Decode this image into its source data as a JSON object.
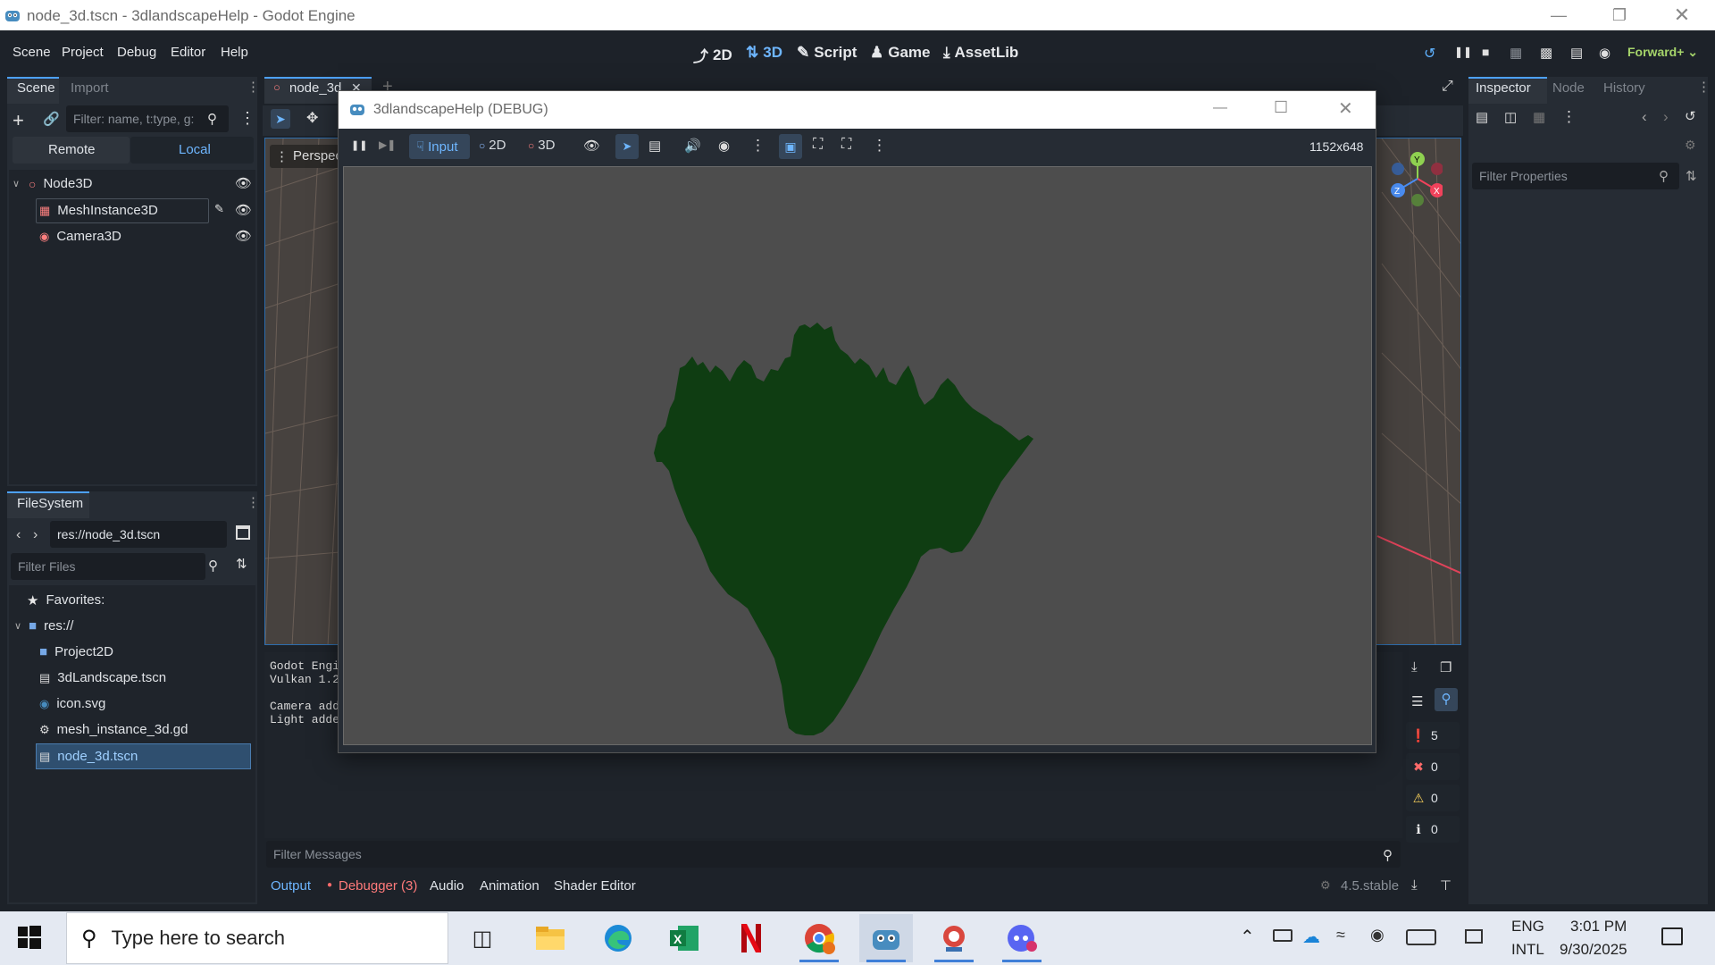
{
  "window": {
    "title": "node_3d.tscn - 3dlandscapeHelp - Godot Engine"
  },
  "menu": [
    "Scene",
    "Project",
    "Debug",
    "Editor",
    "Help"
  ],
  "workspaces": {
    "w2d": "2D",
    "w3d": "3D",
    "script": "Script",
    "game": "Game",
    "assetlib": "AssetLib"
  },
  "renderer": "Forward+",
  "scene_dock": {
    "tabs": [
      "Scene",
      "Import"
    ],
    "filter_placeholder": "Filter: name, t:type, g:",
    "remote": "Remote",
    "local": "Local",
    "nodes": [
      {
        "label": "Node3D"
      },
      {
        "label": "MeshInstance3D"
      },
      {
        "label": "Camera3D"
      }
    ]
  },
  "filesystem": {
    "title": "FileSystem",
    "path": "res://node_3d.tscn",
    "filter_placeholder": "Filter Files",
    "items": [
      {
        "label": "Favorites:"
      },
      {
        "label": "res://"
      },
      {
        "label": "Project2D"
      },
      {
        "label": "3dLandscape.tscn"
      },
      {
        "label": "icon.svg"
      },
      {
        "label": "mesh_instance_3d.gd"
      },
      {
        "label": "node_3d.tscn"
      }
    ]
  },
  "editor_tab": {
    "label": "node_3d"
  },
  "viewport": {
    "label": "Perspec"
  },
  "output": {
    "lines": [
      "Godot Engi",
      "Vulkan 1.2",
      "",
      "Camera add",
      "Light adde"
    ],
    "filter_placeholder": "Filter Messages",
    "tabs": [
      "Output",
      "Debugger (3)",
      "Audio",
      "Animation",
      "Shader Editor"
    ],
    "version": "4.5.stable",
    "counts": {
      "messages": "5",
      "errors": "0",
      "warnings": "0",
      "info": "0"
    }
  },
  "inspector": {
    "tabs": [
      "Inspector",
      "Node",
      "History"
    ],
    "filter_placeholder": "Filter Properties"
  },
  "game_window": {
    "title": "3dlandscapeHelp (DEBUG)",
    "toolbar": {
      "input": "Input",
      "mode2d": "2D",
      "mode3d": "3D",
      "resolution": "1152x648"
    },
    "terrain_color": "#0f3d12",
    "bg_color": "#4d4d4d"
  },
  "taskbar": {
    "search_placeholder": "Type here to search",
    "lang": "ENG",
    "lang2": "INTL",
    "time": "3:01 PM",
    "date": "9/30/2025"
  }
}
